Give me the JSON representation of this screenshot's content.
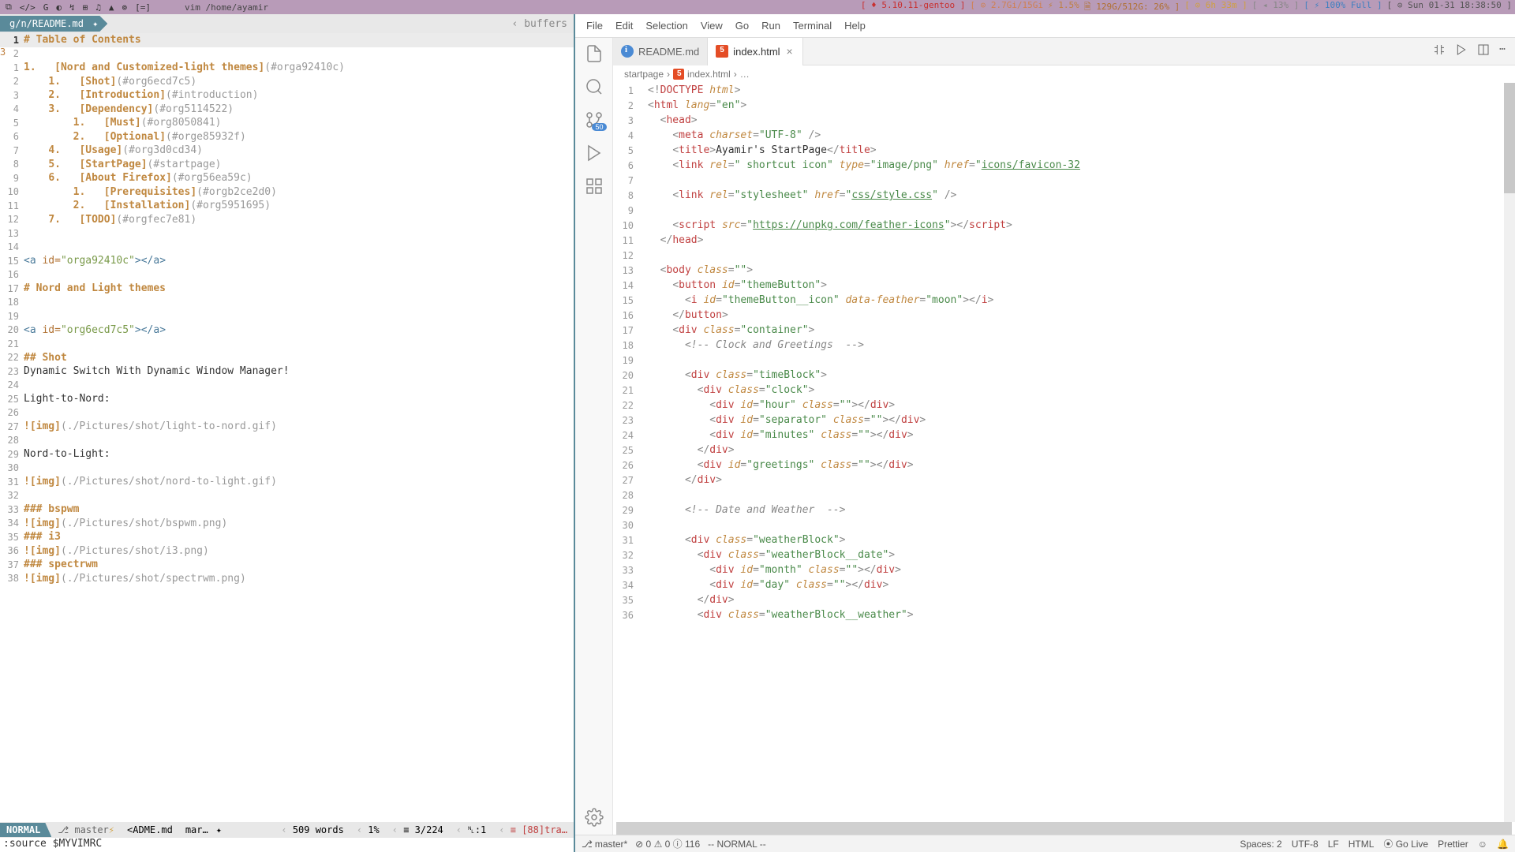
{
  "topbar": {
    "cmd": "vim  /home/ayamir",
    "kernel": "[ ♦ 5.10.11-gentoo ]",
    "mem": "[ ⊙ 2.7Gi/15Gi",
    "cpu": "⚡ 1.5%",
    "disk": "🗎 129G/512G: 26% ]",
    "uptime": "[ ⊙ 6h 33m ]",
    "vol": "[ ◂ 13% ]",
    "bat": "[ ⚡ 100% Full ]",
    "date": "[ ⊙ Sun 01-31",
    "time": "18:38:50 ]"
  },
  "vim": {
    "tab": "g/n/README.md",
    "dirty": "✦",
    "buffers_label": "buffers",
    "margin_num": "3",
    "lines": [
      {
        "n": "1",
        "cls": "cursor",
        "html": "<span class='md-h'># Table of Contents</span>"
      },
      {
        "n": "2",
        "html": ""
      },
      {
        "n": "1",
        "html": "<span class='md-num'>1.</span>   <span class='md-link'>[Nord and Customized-light themes]</span><span class='md-anchor'>(#orga92410c)</span>"
      },
      {
        "n": "2",
        "html": "    <span class='md-num'>1.</span>   <span class='md-link'>[Shot]</span><span class='md-anchor'>(#org6ecd7c5)</span>"
      },
      {
        "n": "3",
        "html": "    <span class='md-num'>2.</span>   <span class='md-link'>[Introduction]</span><span class='md-anchor'>(#introduction)</span>"
      },
      {
        "n": "4",
        "html": "    <span class='md-num'>3.</span>   <span class='md-link'>[Dependency]</span><span class='md-anchor'>(#org5114522)</span>"
      },
      {
        "n": "5",
        "html": "        <span class='md-num'>1.</span>   <span class='md-link'>[Must]</span><span class='md-anchor'>(#org8050841)</span>"
      },
      {
        "n": "6",
        "html": "        <span class='md-num'>2.</span>   <span class='md-link'>[Optional]</span><span class='md-anchor'>(#orge85932f)</span>"
      },
      {
        "n": "7",
        "html": "    <span class='md-num'>4.</span>   <span class='md-link'>[Usage]</span><span class='md-anchor'>(#org3d0cd34)</span>"
      },
      {
        "n": "8",
        "html": "    <span class='md-num'>5.</span>   <span class='md-link'>[StartPage]</span><span class='md-anchor'>(#startpage)</span>"
      },
      {
        "n": "9",
        "html": "    <span class='md-num'>6.</span>   <span class='md-link'>[About Firefox]</span><span class='md-anchor'>(#org56ea59c)</span>"
      },
      {
        "n": "10",
        "html": "        <span class='md-num'>1.</span>   <span class='md-link'>[Prerequisites]</span><span class='md-anchor'>(#orgb2ce2d0)</span>"
      },
      {
        "n": "11",
        "html": "        <span class='md-num'>2.</span>   <span class='md-link'>[Installation]</span><span class='md-anchor'>(#org5951695)</span>"
      },
      {
        "n": "12",
        "html": "    <span class='md-num'>7.</span>   <span class='md-link'>[TODO]</span><span class='md-anchor'>(#orgfec7e81)</span>"
      },
      {
        "n": "13",
        "html": ""
      },
      {
        "n": "14",
        "html": ""
      },
      {
        "n": "15",
        "html": "<span class='md-tag'>&lt;a</span> <span class='md-attr'>id=</span><span class='md-str'>\"orga92410c\"</span><span class='md-tag'>&gt;&lt;/a&gt;</span>"
      },
      {
        "n": "16",
        "html": ""
      },
      {
        "n": "17",
        "html": "<span class='md-h'># Nord and Light themes</span>"
      },
      {
        "n": "18",
        "html": ""
      },
      {
        "n": "19",
        "html": ""
      },
      {
        "n": "20",
        "html": "<span class='md-tag'>&lt;a</span> <span class='md-attr'>id=</span><span class='md-str'>\"org6ecd7c5\"</span><span class='md-tag'>&gt;&lt;/a&gt;</span>"
      },
      {
        "n": "21",
        "html": ""
      },
      {
        "n": "22",
        "html": "<span class='md-h'>## Shot</span>"
      },
      {
        "n": "23",
        "html": "<span class='md-text'>Dynamic Switch With Dynamic Window Manager!</span>"
      },
      {
        "n": "24",
        "html": ""
      },
      {
        "n": "25",
        "html": "<span class='md-text'>Light-to-Nord:</span>"
      },
      {
        "n": "26",
        "html": ""
      },
      {
        "n": "27",
        "html": "<span class='md-img'>![img]</span><span class='md-anchor'>(./Pictures/shot/light-to-nord.gif)</span>"
      },
      {
        "n": "28",
        "html": ""
      },
      {
        "n": "29",
        "html": "<span class='md-text'>Nord-to-Light:</span>"
      },
      {
        "n": "30",
        "html": ""
      },
      {
        "n": "31",
        "html": "<span class='md-img'>![img]</span><span class='md-anchor'>(./Pictures/shot/nord-to-light.gif)</span>"
      },
      {
        "n": "32",
        "html": ""
      },
      {
        "n": "33",
        "html": "<span class='md-h'>### bspwm</span>"
      },
      {
        "n": "34",
        "html": "<span class='md-img'>![img]</span><span class='md-anchor'>(./Pictures/shot/bspwm.png)</span>"
      },
      {
        "n": "35",
        "html": "<span class='md-h'>### i3</span>"
      },
      {
        "n": "36",
        "html": "<span class='md-img'>![img]</span><span class='md-anchor'>(./Pictures/shot/i3.png)</span>"
      },
      {
        "n": "37",
        "html": "<span class='md-h'>### spectrwm</span>"
      },
      {
        "n": "38",
        "html": "<span class='md-img'>![img]</span><span class='md-anchor'>(./Pictures/shot/spectrwm.png)</span>"
      }
    ],
    "status": {
      "mode": "NORMAL",
      "branch": "master",
      "file": "<ADME.md",
      "ft": "mar…",
      "words": "509 words",
      "pct": "1%",
      "pos": "3/224",
      "col": "␤:1",
      "trail": "[88]tra…"
    },
    "cmdline": ":source $MYVIMRC"
  },
  "vscode": {
    "menu": [
      "File",
      "Edit",
      "Selection",
      "View",
      "Go",
      "Run",
      "Terminal",
      "Help"
    ],
    "tabs": [
      {
        "name": "README.md",
        "icon": "info",
        "active": false
      },
      {
        "name": "index.html",
        "icon": "html",
        "active": true
      }
    ],
    "crumb": [
      "startpage",
      "index.html",
      "…"
    ],
    "scm_badge": "50",
    "lines": [
      {
        "n": 1,
        "html": "<span class='c-punc'>&lt;!</span><span class='c-red'>DOCTYPE</span> <span class='c-attr'>html</span><span class='c-punc'>&gt;</span>"
      },
      {
        "n": 2,
        "html": "<span class='c-punc'>&lt;</span><span class='c-red'>html</span> <span class='c-attr'>lang</span><span class='c-punc'>=</span><span class='c-str'>\"en\"</span><span class='c-punc'>&gt;</span>"
      },
      {
        "n": 3,
        "html": "  <span class='c-punc'>&lt;</span><span class='c-red'>head</span><span class='c-punc'>&gt;</span>"
      },
      {
        "n": 4,
        "html": "    <span class='c-punc'>&lt;</span><span class='c-red'>meta</span> <span class='c-attr'>charset</span><span class='c-punc'>=</span><span class='c-str'>\"UTF-8\"</span> <span class='c-punc'>/&gt;</span>"
      },
      {
        "n": 5,
        "html": "    <span class='c-punc'>&lt;</span><span class='c-red'>title</span><span class='c-punc'>&gt;</span><span class='c-txt'>Ayamir's StartPage</span><span class='c-punc'>&lt;/</span><span class='c-red'>title</span><span class='c-punc'>&gt;</span>"
      },
      {
        "n": 6,
        "html": "    <span class='c-punc'>&lt;</span><span class='c-red'>link</span> <span class='c-attr'>rel</span><span class='c-punc'>=</span><span class='c-str'>\" shortcut icon\"</span> <span class='c-attr'>type</span><span class='c-punc'>=</span><span class='c-str'>\"image/png\"</span> <span class='c-attr'>href</span><span class='c-punc'>=</span><span class='c-str'>\"</span><span class='c-link'>icons/favicon-32</span>"
      },
      {
        "n": 7,
        "html": ""
      },
      {
        "n": 8,
        "html": "    <span class='c-punc'>&lt;</span><span class='c-red'>link</span> <span class='c-attr'>rel</span><span class='c-punc'>=</span><span class='c-str'>\"stylesheet\"</span> <span class='c-attr'>href</span><span class='c-punc'>=</span><span class='c-str'>\"</span><span class='c-link'>css/style.css</span><span class='c-str'>\"</span> <span class='c-punc'>/&gt;</span>"
      },
      {
        "n": 9,
        "html": ""
      },
      {
        "n": 10,
        "html": "    <span class='c-punc'>&lt;</span><span class='c-red'>script</span> <span class='c-attr'>src</span><span class='c-punc'>=</span><span class='c-str'>\"</span><span class='c-link'>https://unpkg.com/feather-icons</span><span class='c-str'>\"</span><span class='c-punc'>&gt;&lt;/</span><span class='c-red'>script</span><span class='c-punc'>&gt;</span>"
      },
      {
        "n": 11,
        "html": "  <span class='c-punc'>&lt;/</span><span class='c-red'>head</span><span class='c-punc'>&gt;</span>"
      },
      {
        "n": 12,
        "html": ""
      },
      {
        "n": 13,
        "html": "  <span class='c-punc'>&lt;</span><span class='c-red'>body</span> <span class='c-attr'>class</span><span class='c-punc'>=</span><span class='c-str'>\"\"</span><span class='c-punc'>&gt;</span>"
      },
      {
        "n": 14,
        "html": "    <span class='c-punc'>&lt;</span><span class='c-red'>button</span> <span class='c-attr'>id</span><span class='c-punc'>=</span><span class='c-str'>\"themeButton\"</span><span class='c-punc'>&gt;</span>"
      },
      {
        "n": 15,
        "html": "      <span class='c-punc'>&lt;</span><span class='c-red'>i</span> <span class='c-attr'>id</span><span class='c-punc'>=</span><span class='c-str'>\"themeButton__icon\"</span> <span class='c-attr'>data-feather</span><span class='c-punc'>=</span><span class='c-str'>\"moon\"</span><span class='c-punc'>&gt;&lt;/</span><span class='c-red'>i</span><span class='c-punc'>&gt;</span>"
      },
      {
        "n": 16,
        "html": "    <span class='c-punc'>&lt;/</span><span class='c-red'>button</span><span class='c-punc'>&gt;</span>"
      },
      {
        "n": 17,
        "html": "    <span class='c-punc'>&lt;</span><span class='c-red'>div</span> <span class='c-attr'>class</span><span class='c-punc'>=</span><span class='c-str'>\"container\"</span><span class='c-punc'>&gt;</span>"
      },
      {
        "n": 18,
        "html": "      <span class='c-cmt'>&lt;!-- Clock and Greetings  --&gt;</span>"
      },
      {
        "n": 19,
        "html": ""
      },
      {
        "n": 20,
        "html": "      <span class='c-punc'>&lt;</span><span class='c-red'>div</span> <span class='c-attr'>class</span><span class='c-punc'>=</span><span class='c-str'>\"timeBlock\"</span><span class='c-punc'>&gt;</span>"
      },
      {
        "n": 21,
        "html": "        <span class='c-punc'>&lt;</span><span class='c-red'>div</span> <span class='c-attr'>class</span><span class='c-punc'>=</span><span class='c-str'>\"clock\"</span><span class='c-punc'>&gt;</span>"
      },
      {
        "n": 22,
        "html": "          <span class='c-punc'>&lt;</span><span class='c-red'>div</span> <span class='c-attr'>id</span><span class='c-punc'>=</span><span class='c-str'>\"hour\"</span> <span class='c-attr'>class</span><span class='c-punc'>=</span><span class='c-str'>\"\"</span><span class='c-punc'>&gt;&lt;/</span><span class='c-red'>div</span><span class='c-punc'>&gt;</span>"
      },
      {
        "n": 23,
        "html": "          <span class='c-punc'>&lt;</span><span class='c-red'>div</span> <span class='c-attr'>id</span><span class='c-punc'>=</span><span class='c-str'>\"separator\"</span> <span class='c-attr'>class</span><span class='c-punc'>=</span><span class='c-str'>\"\"</span><span class='c-punc'>&gt;&lt;/</span><span class='c-red'>div</span><span class='c-punc'>&gt;</span>"
      },
      {
        "n": 24,
        "html": "          <span class='c-punc'>&lt;</span><span class='c-red'>div</span> <span class='c-attr'>id</span><span class='c-punc'>=</span><span class='c-str'>\"minutes\"</span> <span class='c-attr'>class</span><span class='c-punc'>=</span><span class='c-str'>\"\"</span><span class='c-punc'>&gt;&lt;/</span><span class='c-red'>div</span><span class='c-punc'>&gt;</span>"
      },
      {
        "n": 25,
        "html": "        <span class='c-punc'>&lt;/</span><span class='c-red'>div</span><span class='c-punc'>&gt;</span>"
      },
      {
        "n": 26,
        "html": "        <span class='c-punc'>&lt;</span><span class='c-red'>div</span> <span class='c-attr'>id</span><span class='c-punc'>=</span><span class='c-str'>\"greetings\"</span> <span class='c-attr'>class</span><span class='c-punc'>=</span><span class='c-str'>\"\"</span><span class='c-punc'>&gt;&lt;/</span><span class='c-red'>div</span><span class='c-punc'>&gt;</span>"
      },
      {
        "n": 27,
        "html": "      <span class='c-punc'>&lt;/</span><span class='c-red'>div</span><span class='c-punc'>&gt;</span>"
      },
      {
        "n": 28,
        "html": ""
      },
      {
        "n": 29,
        "html": "      <span class='c-cmt'>&lt;!-- Date and Weather  --&gt;</span>"
      },
      {
        "n": 30,
        "html": ""
      },
      {
        "n": 31,
        "html": "      <span class='c-punc'>&lt;</span><span class='c-red'>div</span> <span class='c-attr'>class</span><span class='c-punc'>=</span><span class='c-str'>\"weatherBlock\"</span><span class='c-punc'>&gt;</span>"
      },
      {
        "n": 32,
        "html": "        <span class='c-punc'>&lt;</span><span class='c-red'>div</span> <span class='c-attr'>class</span><span class='c-punc'>=</span><span class='c-str'>\"weatherBlock__date\"</span><span class='c-punc'>&gt;</span>"
      },
      {
        "n": 33,
        "html": "          <span class='c-punc'>&lt;</span><span class='c-red'>div</span> <span class='c-attr'>id</span><span class='c-punc'>=</span><span class='c-str'>\"month\"</span> <span class='c-attr'>class</span><span class='c-punc'>=</span><span class='c-str'>\"\"</span><span class='c-punc'>&gt;&lt;/</span><span class='c-red'>div</span><span class='c-punc'>&gt;</span>"
      },
      {
        "n": 34,
        "html": "          <span class='c-punc'>&lt;</span><span class='c-red'>div</span> <span class='c-attr'>id</span><span class='c-punc'>=</span><span class='c-str'>\"day\"</span> <span class='c-attr'>class</span><span class='c-punc'>=</span><span class='c-str'>\"\"</span><span class='c-punc'>&gt;&lt;/</span><span class='c-red'>div</span><span class='c-punc'>&gt;</span>"
      },
      {
        "n": 35,
        "html": "        <span class='c-punc'>&lt;/</span><span class='c-red'>div</span><span class='c-punc'>&gt;</span>"
      },
      {
        "n": 36,
        "html": "        <span class='c-punc'>&lt;</span><span class='c-red'>div</span> <span class='c-attr'>class</span><span class='c-punc'>=</span><span class='c-str'>\"weatherBlock__weather\"</span><span class='c-punc'>&gt;</span>"
      }
    ],
    "status": {
      "branch": "master*",
      "errs": "⊘ 0 ⚠ 0 ⓘ 116",
      "mode": "-- NORMAL --",
      "spaces": "Spaces: 2",
      "enc": "UTF-8",
      "eol": "LF",
      "lang": "HTML",
      "live": "⦿ Go Live",
      "fmt": "Prettier"
    }
  }
}
